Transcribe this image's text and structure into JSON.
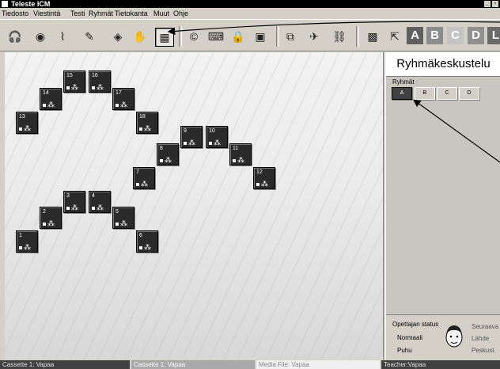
{
  "window": {
    "title": "Teleste ICM"
  },
  "menu": [
    "Tiedosto",
    "Viestintä",
    "Testi",
    "Ryhmät",
    "Tietokanta",
    "Muut",
    "Ohje"
  ],
  "toolbar": {
    "icons": [
      "headset-icon",
      "speaker-icon",
      "microphone-icon",
      "pen-icon",
      "eye-icon",
      "hand-icon",
      "group-seats-icon",
      "copyright-icon",
      "keyboard-icon",
      "lock-icon",
      "monitor-icon",
      "screen-share-icon",
      "broadcast-icon",
      "link-icon",
      "grid-icon",
      "cursor-icon"
    ],
    "group_buttons": [
      {
        "label": "A",
        "color": "#606060"
      },
      {
        "label": "B",
        "color": "#8c8c8c"
      },
      {
        "label": "C",
        "color": "#c4c4c4"
      },
      {
        "label": "D",
        "color": "#909090"
      },
      {
        "label": "L",
        "color": "#6a6a6a"
      }
    ]
  },
  "seats": [
    "1",
    "2",
    "3",
    "4",
    "5",
    "6",
    "7",
    "8",
    "9",
    "10",
    "11",
    "12",
    "13",
    "14",
    "15",
    "16",
    "17",
    "18"
  ],
  "panel": {
    "title": "Ryhmäkeskustelu",
    "groups_label": "Ryhmät",
    "groups": [
      "A",
      "B",
      "C",
      "D"
    ],
    "active_group": "A",
    "teacher_status_label": "Opettajan status",
    "status_left": [
      "Normaali",
      "Puhu"
    ],
    "status_right": [
      "Seuraava",
      "Lähde",
      "Peskust."
    ]
  },
  "statusbar": {
    "segments": [
      "Cassette 1: Vapaa",
      "Cassette 1: Vapaa",
      "Media File: Vapaa",
      "Teacher:Vapaa"
    ]
  }
}
